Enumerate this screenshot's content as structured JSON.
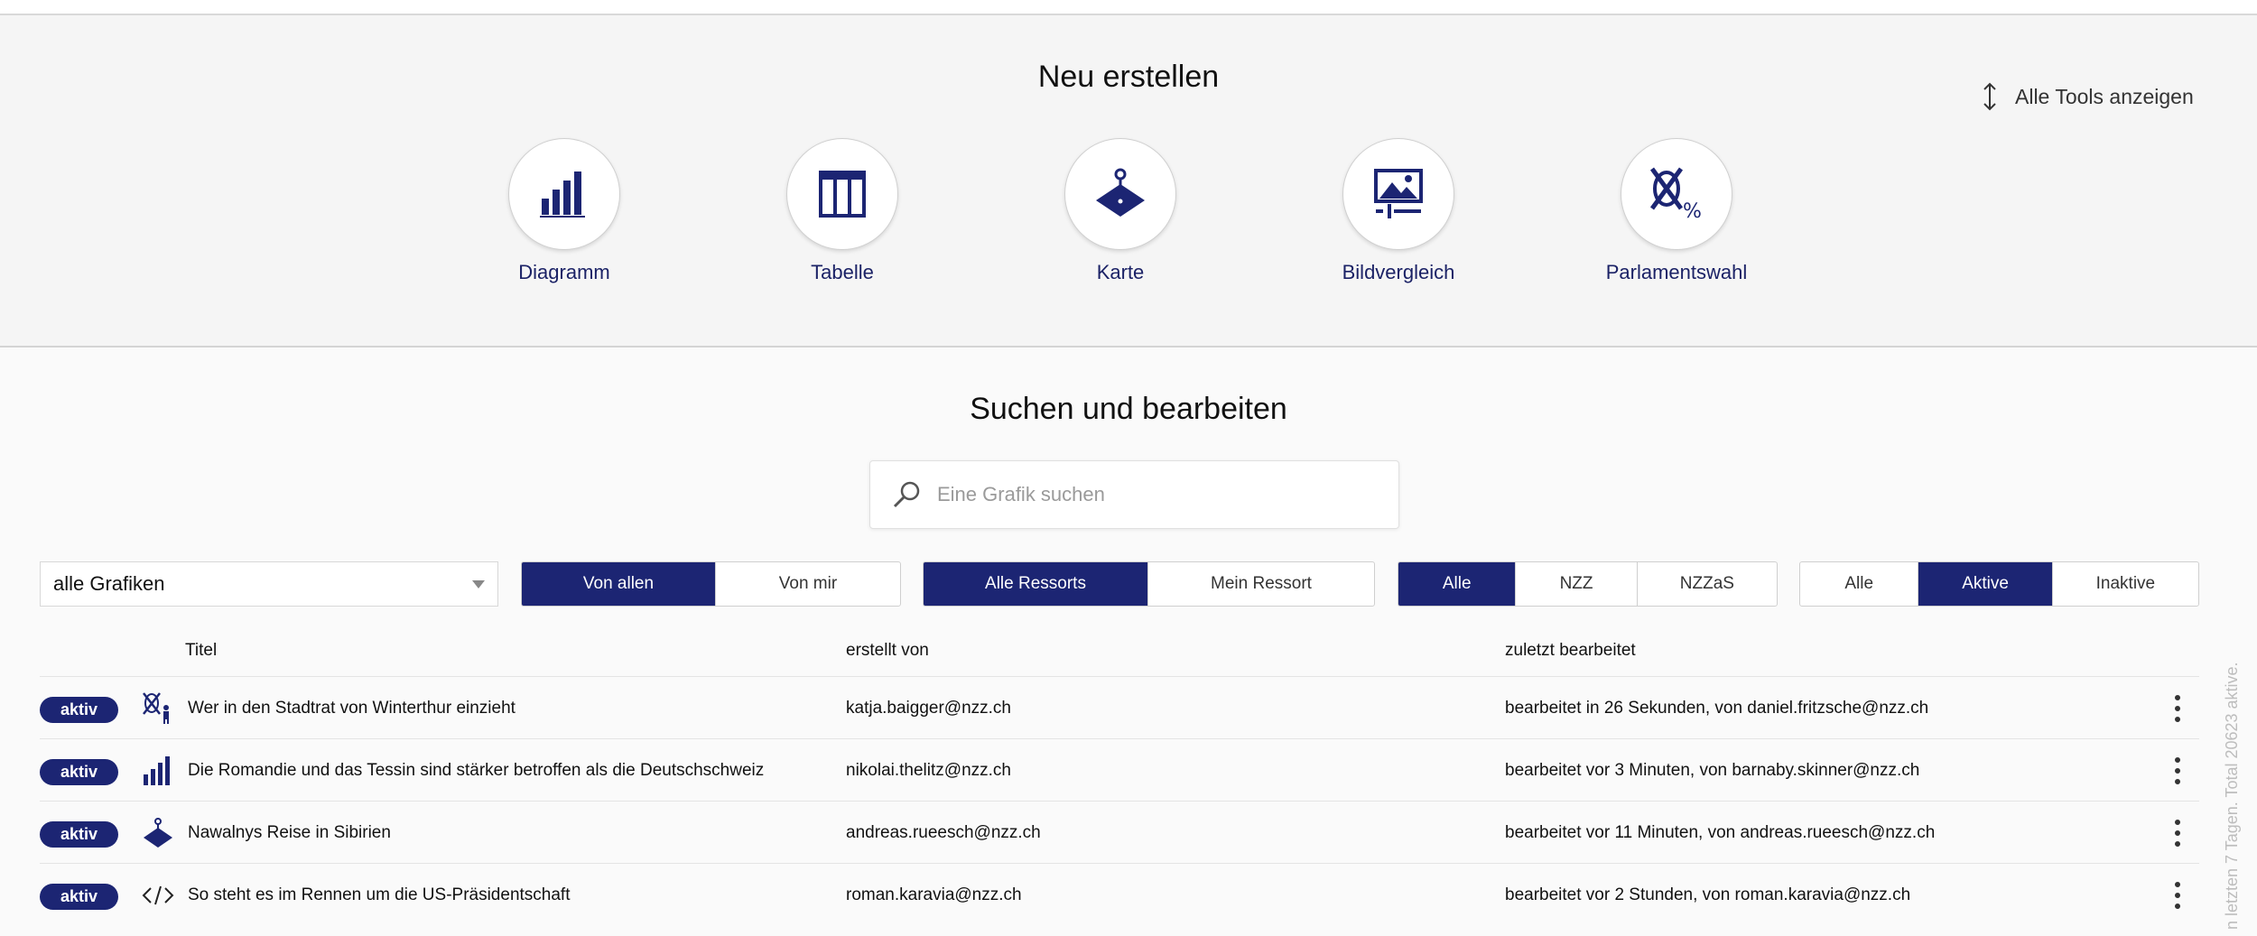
{
  "create": {
    "title": "Neu erstellen",
    "show_all_tools": "Alle Tools anzeigen",
    "tools": [
      {
        "label": "Diagramm",
        "icon": "bar-chart-icon"
      },
      {
        "label": "Tabelle",
        "icon": "table-icon"
      },
      {
        "label": "Karte",
        "icon": "map-pin-icon"
      },
      {
        "label": "Bildvergleich",
        "icon": "image-compare-icon"
      },
      {
        "label": "Parlamentswahl",
        "icon": "election-icon"
      }
    ]
  },
  "search": {
    "title": "Suchen und bearbeiten",
    "placeholder": "Eine Grafik suchen",
    "value": ""
  },
  "filters": {
    "type_select": "alle Grafiken",
    "owner": {
      "options": [
        "Von allen",
        "Von mir"
      ],
      "selected": "Von allen"
    },
    "ressort": {
      "options": [
        "Alle Ressorts",
        "Mein Ressort"
      ],
      "selected": "Alle Ressorts"
    },
    "publication": {
      "options": [
        "Alle",
        "NZZ",
        "NZZaS"
      ],
      "selected": "Alle"
    },
    "status": {
      "options": [
        "Alle",
        "Aktive",
        "Inaktive"
      ],
      "selected": "Aktive"
    }
  },
  "table": {
    "headers": {
      "title": "Titel",
      "creator": "erstellt von",
      "edited": "zuletzt bearbeitet"
    },
    "rows": [
      {
        "status": "aktiv",
        "icon": "election-icon",
        "title": "Wer in den Stadtrat von Winterthur einzieht",
        "creator": "katja.baigger@nzz.ch",
        "edited": "bearbeitet in 26 Sekunden, von daniel.fritzsche@nzz.ch"
      },
      {
        "status": "aktiv",
        "icon": "bar-chart-icon",
        "title": "Die Romandie und das Tessin sind stärker betroffen als die Deutschschweiz",
        "creator": "nikolai.thelitz@nzz.ch",
        "edited": "bearbeitet vor 3 Minuten, von barnaby.skinner@nzz.ch"
      },
      {
        "status": "aktiv",
        "icon": "map-pin-icon",
        "title": "Nawalnys Reise in Sibirien",
        "creator": "andreas.rueesch@nzz.ch",
        "edited": "bearbeitet vor 11 Minuten, von andreas.rueesch@nzz.ch"
      },
      {
        "status": "aktiv",
        "icon": "code-icon",
        "title": "So steht es im Rennen um die US-Präsidentschaft",
        "creator": "roman.karavia@nzz.ch",
        "edited": "bearbeitet vor 2 Stunden, von roman.karavia@nzz.ch"
      }
    ]
  },
  "side_note": "n letzten 7 Tagen. Total 20623 aktive.",
  "colors": {
    "accent": "#1c2573",
    "accent_text": "#1b2266"
  }
}
